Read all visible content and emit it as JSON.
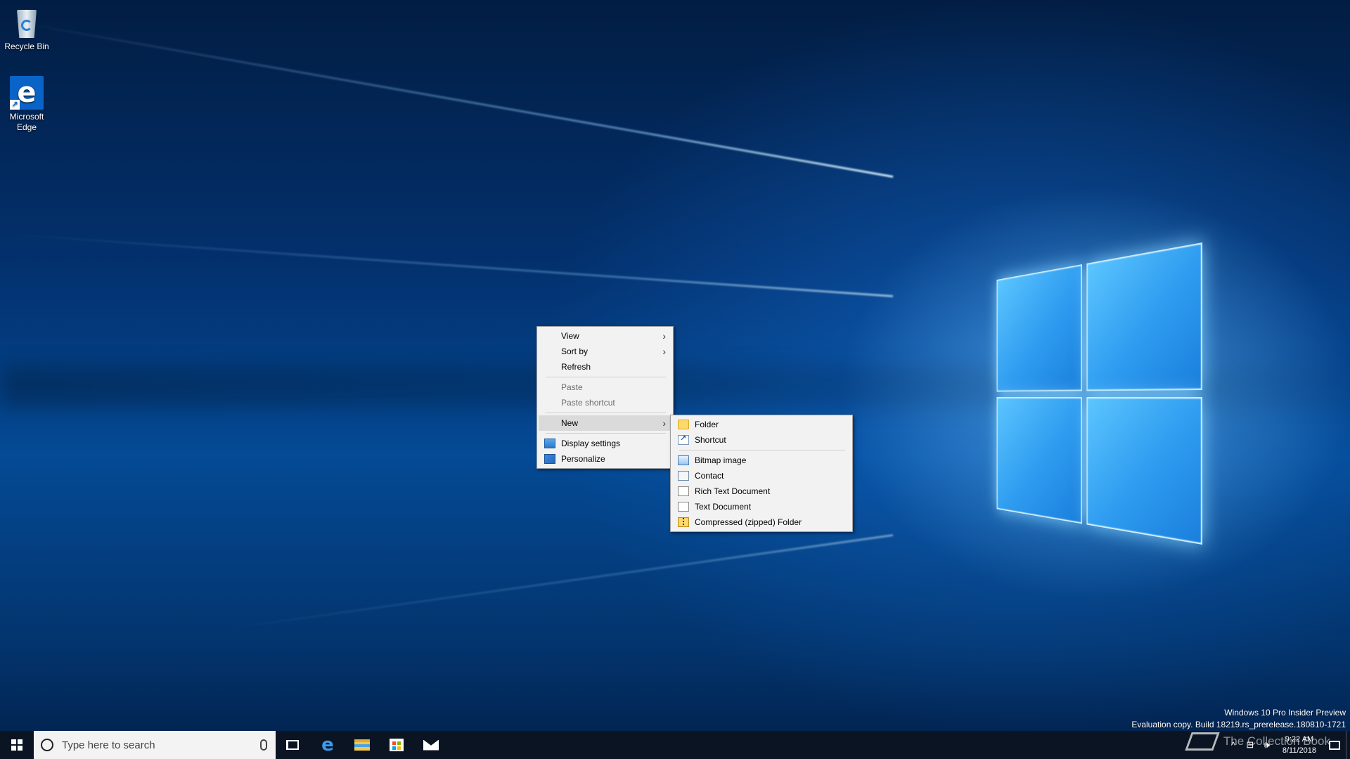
{
  "desktop": {
    "icons": [
      {
        "label": "Recycle Bin",
        "icon": "recycle-bin-icon"
      },
      {
        "label": "Microsoft Edge",
        "icon": "edge-icon"
      }
    ]
  },
  "context_menu": {
    "items": [
      {
        "label": "View",
        "has_submenu": true,
        "enabled": true
      },
      {
        "label": "Sort by",
        "has_submenu": true,
        "enabled": true
      },
      {
        "label": "Refresh",
        "enabled": true
      },
      {
        "label": "Paste",
        "enabled": false
      },
      {
        "label": "Paste shortcut",
        "enabled": false
      },
      {
        "label": "New",
        "has_submenu": true,
        "enabled": true,
        "highlighted": true
      },
      {
        "label": "Display settings",
        "icon": "display-settings-icon",
        "enabled": true
      },
      {
        "label": "Personalize",
        "icon": "personalize-icon",
        "enabled": true
      }
    ],
    "submenu_arrow": "›"
  },
  "new_submenu": {
    "items": [
      {
        "label": "Folder",
        "icon": "folder-icon"
      },
      {
        "label": "Shortcut",
        "icon": "shortcut-icon"
      },
      {
        "label": "Bitmap image",
        "icon": "bitmap-icon"
      },
      {
        "label": "Contact",
        "icon": "contact-icon"
      },
      {
        "label": "Rich Text Document",
        "icon": "rich-text-icon"
      },
      {
        "label": "Text Document",
        "icon": "text-document-icon"
      },
      {
        "label": "Compressed (zipped) Folder",
        "icon": "zip-folder-icon"
      }
    ]
  },
  "watermark": {
    "line1": "Windows 10 Pro Insider Preview",
    "line2": "Evaluation copy. Build 18219.rs_prerelease.180810-1721"
  },
  "taskbar": {
    "search_placeholder": "Type here to search",
    "pinned": [
      "task-view-icon",
      "edge-icon",
      "file-explorer-icon",
      "store-icon",
      "mail-icon"
    ],
    "clock_time": "9:22 AM",
    "clock_date": "8/11/2018",
    "brand_watermark": "The Collection Book"
  }
}
